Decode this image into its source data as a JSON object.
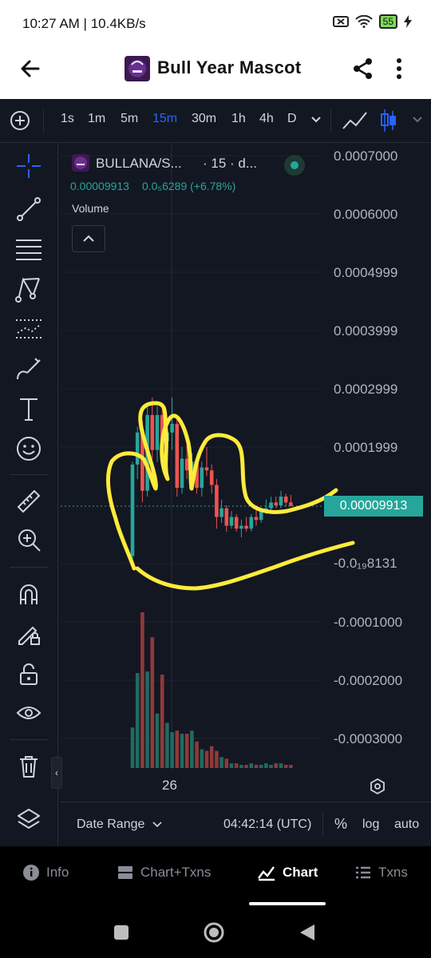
{
  "status_bar": {
    "time": "10:27 AM | 10.4KB/s",
    "battery": "55"
  },
  "app_bar": {
    "title": "Bull Year Mascot",
    "icons": [
      "back-arrow-icon",
      "share-icon",
      "more-vert-icon"
    ]
  },
  "toolbar": {
    "timeframes": [
      "1s",
      "1m",
      "5m",
      "15m",
      "30m",
      "1h",
      "4h",
      "D"
    ],
    "active_timeframe": "15m",
    "accent_color": "#2962ff"
  },
  "left_tools": [
    "crosshair-icon",
    "trend-line-icon",
    "fib-retracement-icon",
    "pattern-icon",
    "prediction-icon",
    "brush-icon",
    "text-icon",
    "emoji-icon",
    "ruler-icon",
    "zoom-in-icon",
    "magnet-icon",
    "lock-drawing-icon",
    "unlock-icon",
    "eye-icon",
    "trash-icon",
    "layers-icon"
  ],
  "chart": {
    "symbol": "BULLANA/S...",
    "interval": "· 15 · d...",
    "last_price": "0.00009913",
    "change": "0.0₅6289 (+6.78%)",
    "volume_label": "Volume",
    "price_tag": "0.00009913",
    "y_axis_labels": [
      "0.0007000",
      "0.0006000",
      "0.0004999",
      "0.0003999",
      "0.0002999",
      "0.0001999",
      "-0.0₁₉8131",
      "-0.0001000",
      "-0.0002000",
      "-0.0003000"
    ],
    "x_axis_label": "26",
    "colors": {
      "up": "#26a69a",
      "down": "#ef5350",
      "annotation": "#ffeb3b"
    }
  },
  "chart_data": {
    "type": "candlestick",
    "symbol": "BULLANA/S...",
    "interval": "15",
    "last_price": 9.913e-05,
    "ylim": [
      -0.0003,
      0.0007
    ],
    "candles": [
      {
        "o": 1.3e-05,
        "h": 0.000175,
        "l": 5e-06,
        "c": 0.00017
      },
      {
        "o": 0.00017,
        "h": 0.000235,
        "l": 0.000145,
        "c": 0.000225
      },
      {
        "o": 0.000225,
        "h": 0.000245,
        "l": 0.000105,
        "c": 0.000125
      },
      {
        "o": 0.000125,
        "h": 0.000275,
        "l": 0.000115,
        "c": 0.000255
      },
      {
        "o": 0.000255,
        "h": 0.000285,
        "l": 0.00018,
        "c": 0.000195
      },
      {
        "o": 0.000195,
        "h": 0.00027,
        "l": 0.000175,
        "c": 0.000255
      },
      {
        "o": 0.000255,
        "h": 0.000265,
        "l": 0.00019,
        "c": 0.00021
      },
      {
        "o": 0.00021,
        "h": 0.00024,
        "l": 0.000195,
        "c": 0.000225
      },
      {
        "o": 0.000225,
        "h": 0.000285,
        "l": 0.000195,
        "c": 0.00024
      },
      {
        "o": 0.00024,
        "h": 0.000255,
        "l": 0.000115,
        "c": 0.00013
      },
      {
        "o": 0.00013,
        "h": 0.0002,
        "l": 0.00012,
        "c": 0.00018
      },
      {
        "o": 0.00018,
        "h": 0.000205,
        "l": 0.000145,
        "c": 0.00016
      },
      {
        "o": 0.00016,
        "h": 0.00019,
        "l": 0.00014,
        "c": 0.000175
      },
      {
        "o": 0.000175,
        "h": 0.00018,
        "l": 0.00012,
        "c": 0.00013
      },
      {
        "o": 0.00013,
        "h": 0.000175,
        "l": 0.000115,
        "c": 0.000165
      },
      {
        "o": 0.000165,
        "h": 0.0002,
        "l": 0.00015,
        "c": 0.00016
      },
      {
        "o": 0.00016,
        "h": 0.00017,
        "l": 0.00012,
        "c": 0.000135
      },
      {
        "o": 0.000135,
        "h": 0.000145,
        "l": 6e-05,
        "c": 8e-05
      },
      {
        "o": 8e-05,
        "h": 0.00011,
        "l": 7e-05,
        "c": 9.5e-05
      },
      {
        "o": 9.5e-05,
        "h": 0.0001,
        "l": 5.5e-05,
        "c": 6.5e-05
      },
      {
        "o": 6.5e-05,
        "h": 9e-05,
        "l": 6e-05,
        "c": 8e-05
      },
      {
        "o": 8e-05,
        "h": 8.5e-05,
        "l": 5.5e-05,
        "c": 6e-05
      },
      {
        "o": 6e-05,
        "h": 7.5e-05,
        "l": 4.5e-05,
        "c": 6.5e-05
      },
      {
        "o": 6.5e-05,
        "h": 8e-05,
        "l": 5.5e-05,
        "c": 6e-05
      },
      {
        "o": 6e-05,
        "h": 8.5e-05,
        "l": 5.5e-05,
        "c": 8e-05
      },
      {
        "o": 8e-05,
        "h": 9.5e-05,
        "l": 6.5e-05,
        "c": 7.5e-05
      },
      {
        "o": 7.5e-05,
        "h": 9.5e-05,
        "l": 7e-05,
        "c": 9e-05
      },
      {
        "o": 9e-05,
        "h": 0.00011,
        "l": 8.5e-05,
        "c": 9.5e-05
      },
      {
        "o": 9.5e-05,
        "h": 0.000115,
        "l": 9e-05,
        "c": 0.000105
      },
      {
        "o": 0.000105,
        "h": 0.000115,
        "l": 9.5e-05,
        "c": 0.0001
      },
      {
        "o": 0.0001,
        "h": 0.000125,
        "l": 9.5e-05,
        "c": 0.000115
      },
      {
        "o": 0.000115,
        "h": 0.00012,
        "l": 9.8e-05,
        "c": 0.000105
      },
      {
        "o": 0.000105,
        "h": 0.000118,
        "l": 9.8e-05,
        "c": 9.9e-05
      }
    ],
    "volumes": [
      0.26,
      0.61,
      1.0,
      0.62,
      0.84,
      0.35,
      0.6,
      0.29,
      0.23,
      0.24,
      0.22,
      0.22,
      0.24,
      0.17,
      0.12,
      0.11,
      0.14,
      0.11,
      0.07,
      0.06,
      0.03,
      0.03,
      0.02,
      0.02,
      0.03,
      0.02,
      0.02,
      0.03,
      0.02,
      0.03,
      0.03,
      0.02,
      0.02
    ]
  },
  "bottom_bar": {
    "date_range": "Date Range",
    "time": "04:42:14 (UTC)",
    "percent": "%",
    "log": "log",
    "auto": "auto"
  },
  "nav_tabs": [
    {
      "label": "Info",
      "icon": "info-icon"
    },
    {
      "label": "Chart+Txns",
      "icon": "chart-txns-icon"
    },
    {
      "label": "Chart",
      "icon": "chart-area-icon",
      "active": true
    },
    {
      "label": "Txns",
      "icon": "list-icon"
    }
  ]
}
